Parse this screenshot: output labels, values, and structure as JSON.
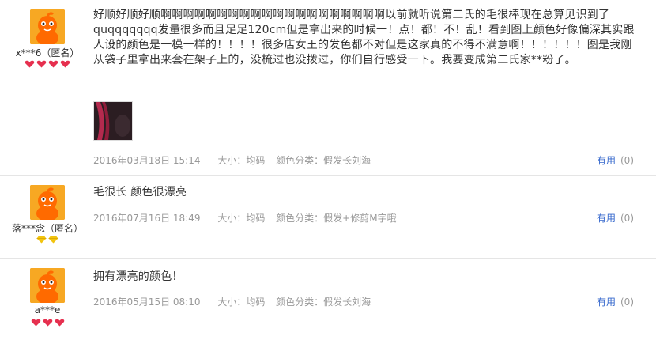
{
  "reviews": [
    {
      "username": "x***6（匿名）",
      "rank_count": 4,
      "rank_color": "#e6304f",
      "content": "好顺好顺好顺啊啊啊啊啊啊啊啊啊啊啊啊啊啊啊啊啊啊啊啊以前就听说第二氏的毛很棒现在总算见识到了quqqqqqqq发量很多而且足足120cm但是拿出来的时候一！点！都！不！乱！看到图上颜色好像偏深其实跟人设的颜色是一模一样的！！！！很多店女王的发色都不对但是这家真的不得不满意啊！！！！！！图是我刚从袋子里拿出来套在架子上的，没梳过也没拨过，你们自行感受一下。我要变成第二氏家**粉了。",
      "has_photo": true,
      "date": "2016年03月18日 15:14",
      "size_label": "大小：均码",
      "color_label": "颜色分类：假发长刘海",
      "useful_label": "有用",
      "useful_count": "(0)"
    },
    {
      "username": "落***念（匿名）",
      "rank_count": 2,
      "rank_color": "#f2c40f",
      "content": "毛很长 颜色很漂亮",
      "has_photo": false,
      "date": "2016年07月16日 18:49",
      "size_label": "大小：均码",
      "color_label": "颜色分类：假发+修剪M字哦",
      "useful_label": "有用",
      "useful_count": "(0)"
    },
    {
      "username": "a***e",
      "rank_count": 3,
      "rank_color": "#e6304f",
      "content": "拥有漂亮的颜色！",
      "has_photo": false,
      "date": "2016年05月15日 08:10",
      "size_label": "大小：均码",
      "color_label": "颜色分类：假发长刘海",
      "useful_label": "有用",
      "useful_count": "(0)"
    }
  ]
}
